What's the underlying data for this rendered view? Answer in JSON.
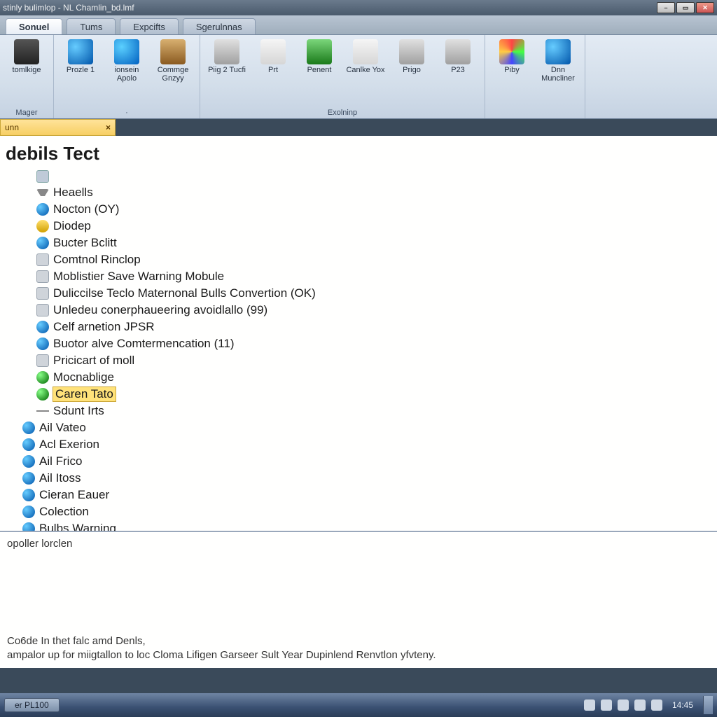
{
  "window": {
    "title": "stinly bulimlop - NL Chamlin_bd.lmf"
  },
  "tabs": [
    {
      "label": "Sonuel",
      "active": true
    },
    {
      "label": "Tums",
      "active": false
    },
    {
      "label": "Expcifts",
      "active": false
    },
    {
      "label": "Sgerulnnas",
      "active": false
    }
  ],
  "ribbon": {
    "groups": [
      {
        "label": "Mager",
        "buttons": [
          {
            "label": "tomlkige",
            "icon": "ic-dark",
            "name": "ribbon-btn-tomlkige"
          }
        ]
      },
      {
        "label": "·",
        "buttons": [
          {
            "label": "Prozle 1",
            "icon": "ic-blue",
            "name": "ribbon-btn-prozle1"
          },
          {
            "label": "ionsein Apolo",
            "icon": "ic-help",
            "name": "ribbon-btn-ionsein-apolo"
          },
          {
            "label": "Commge Gnzyy",
            "icon": "ic-brown",
            "name": "ribbon-btn-commge-gnzyy"
          }
        ]
      },
      {
        "label": "Exolninp",
        "buttons": [
          {
            "label": "Piig 2 Tucfi",
            "icon": "ic-grey",
            "name": "ribbon-btn-piig2"
          },
          {
            "label": "Prt",
            "icon": "ic-pale",
            "name": "ribbon-btn-prt"
          },
          {
            "label": "Penent",
            "icon": "ic-green",
            "name": "ribbon-btn-penent"
          },
          {
            "label": "Canlke Yox",
            "icon": "ic-pale",
            "name": "ribbon-btn-canlke-yox"
          },
          {
            "label": "Prigo",
            "icon": "ic-grey",
            "name": "ribbon-btn-prigo"
          },
          {
            "label": "P23",
            "icon": "ic-grey",
            "name": "ribbon-btn-p23"
          }
        ]
      },
      {
        "label": "",
        "buttons": [
          {
            "label": "Piby",
            "icon": "ic-multi",
            "name": "ribbon-btn-piby"
          },
          {
            "label": "Dnn Muncliner",
            "icon": "ic-blue",
            "name": "ribbon-btn-dnn-muncliner"
          }
        ]
      }
    ]
  },
  "panel": {
    "title": "unn",
    "close": "×"
  },
  "heading": "debils Tect",
  "tree": [
    {
      "icon": "ni-sq",
      "label": "",
      "sub": true
    },
    {
      "icon": "ni-tri",
      "label": "Heaells",
      "sub": true
    },
    {
      "icon": "ni-blue",
      "label": "Nocton (OY)",
      "sub": true
    },
    {
      "icon": "ni-yel",
      "label": "Diodep",
      "sub": true
    },
    {
      "icon": "ni-blue",
      "label": "Bucter Bclitt",
      "sub": true
    },
    {
      "icon": "ni-grey",
      "label": "Comtnol Rinclop",
      "sub": true
    },
    {
      "icon": "ni-grey",
      "label": "Moblistier Save Warning Mobule",
      "sub": true
    },
    {
      "icon": "ni-grey",
      "label": "Duliccilse Teclo Maternonal Bulls Convertion (OK)",
      "sub": true
    },
    {
      "icon": "ni-grey",
      "label": "Unledeu conerphaueering avoidlallo (99)",
      "sub": true
    },
    {
      "icon": "ni-blue",
      "label": "Celf arnetion JPSR",
      "sub": true
    },
    {
      "icon": "ni-blue",
      "label": "Buotor alve Comtermencation (11)",
      "sub": true
    },
    {
      "icon": "ni-grey",
      "label": "Pricicart of moll",
      "sub": true
    },
    {
      "icon": "ni-grn",
      "label": "Mocnablige",
      "sub": true
    },
    {
      "icon": "ni-grn",
      "label": "Caren Tato",
      "sub": true,
      "selected": true
    },
    {
      "icon": "ni-dash",
      "label": "Sdunt Irts",
      "sub": true
    },
    {
      "icon": "ni-blue",
      "label": "Ail Vateo"
    },
    {
      "icon": "ni-blue",
      "label": "Acl Exerion"
    },
    {
      "icon": "ni-blue",
      "label": "Ail Frico"
    },
    {
      "icon": "ni-blue",
      "label": "Ail Itoss"
    },
    {
      "icon": "ni-blue",
      "label": "Cieran Eauer"
    },
    {
      "icon": "ni-blue",
      "label": "Colection"
    },
    {
      "icon": "ni-blue",
      "label": "Bulbs Warning"
    }
  ],
  "lower": {
    "heading": "opoller lorclen",
    "line1": "Co6de In thet falc amd Denls,",
    "line2": "ampalor up for miigtallon to loc Cloma Lifigen Garseer Sult Year Dupinlend Renvtlon yfvteny."
  },
  "taskbar": {
    "task": "er PL100",
    "clock": "14:45"
  }
}
